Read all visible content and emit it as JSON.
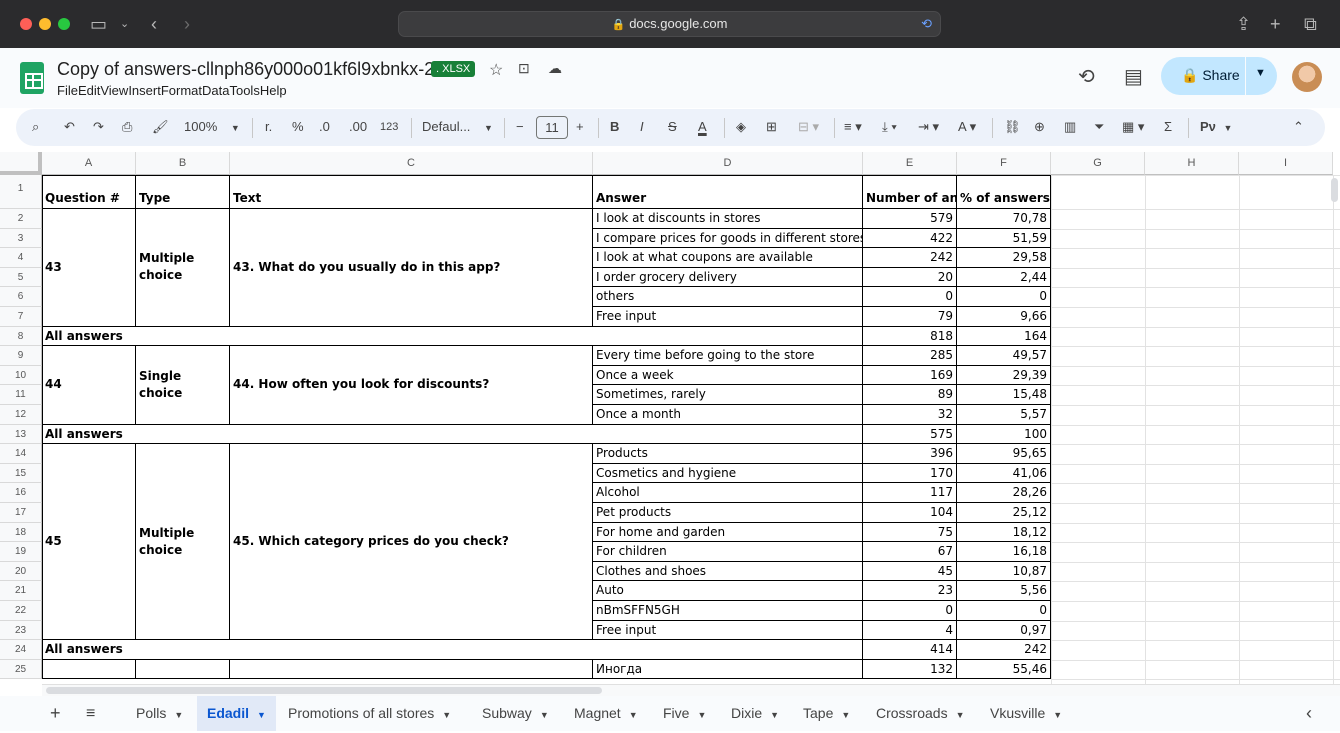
{
  "browser": {
    "url": "docs.google.com"
  },
  "doc": {
    "title": "Copy of answers-cllnph86y000o01kf6l9xbnkx-2",
    "badge": ". XLSX"
  },
  "menu": [
    "File",
    "Edit",
    "View",
    "Insert",
    "Format",
    "Data",
    "Tools",
    "Help"
  ],
  "share": {
    "label": "Share"
  },
  "toolbar": {
    "zoom": "100%",
    "currency": "r.",
    "percent": "%",
    "dec_less": ".0",
    "dec_more": ".00",
    "format123": "123",
    "font": "Defaul...",
    "font_size": "11",
    "bold": "B",
    "italic": "I",
    "strike": "S",
    "text_color": "A",
    "sum": "Σ",
    "input_tools": "Рν"
  },
  "columns": [
    "A",
    "B",
    "C",
    "D",
    "E",
    "F",
    "G",
    "H",
    "I"
  ],
  "rows": [
    {
      "n": "1",
      "a": "Question #",
      "b": "Type",
      "c": "Text",
      "d": "Answer",
      "e": "Number of answers",
      "f": "% of answers"
    },
    {
      "n": "2",
      "d": "I look at discounts in stores",
      "e": "579",
      "f": "70,78"
    },
    {
      "n": "3",
      "d": "I compare prices for goods in different stores",
      "e": "422",
      "f": "51,59"
    },
    {
      "n": "4",
      "d": "I look at what coupons are available",
      "e": "242",
      "f": "29,58"
    },
    {
      "n": "5",
      "d": "I order grocery delivery",
      "e": "20",
      "f": "2,44"
    },
    {
      "n": "6",
      "d": "others",
      "e": "0",
      "f": "0"
    },
    {
      "n": "7",
      "d": "Free input",
      "e": "79",
      "f": "9,66"
    },
    {
      "n": "8",
      "a": "All answers",
      "e": "818",
      "f": "164"
    },
    {
      "n": "9",
      "d": "Every time before going to the store",
      "e": "285",
      "f": "49,57"
    },
    {
      "n": "10",
      "d": "Once a week",
      "e": "169",
      "f": "29,39"
    },
    {
      "n": "11",
      "d": "Sometimes, rarely",
      "e": "89",
      "f": "15,48"
    },
    {
      "n": "12",
      "d": "Once a month",
      "e": "32",
      "f": "5,57"
    },
    {
      "n": "13",
      "a": "All answers",
      "e": "575",
      "f": "100"
    },
    {
      "n": "14",
      "d": "Products",
      "e": "396",
      "f": "95,65"
    },
    {
      "n": "15",
      "d": "Cosmetics and hygiene",
      "e": "170",
      "f": "41,06"
    },
    {
      "n": "16",
      "d": "Alcohol",
      "e": "117",
      "f": "28,26"
    },
    {
      "n": "17",
      "d": "Pet products",
      "e": "104",
      "f": "25,12"
    },
    {
      "n": "18",
      "d": "For home and garden",
      "e": "75",
      "f": "18,12"
    },
    {
      "n": "19",
      "d": "For children",
      "e": "67",
      "f": "16,18"
    },
    {
      "n": "20",
      "d": "Clothes and shoes",
      "e": "45",
      "f": "10,87"
    },
    {
      "n": "21",
      "d": "Auto",
      "e": "23",
      "f": "5,56"
    },
    {
      "n": "22",
      "d": "nBmSFFN5GH",
      "e": "0",
      "f": "0"
    },
    {
      "n": "23",
      "d": "Free input",
      "e": "4",
      "f": "0,97"
    },
    {
      "n": "24",
      "a": "All answers",
      "e": "414",
      "f": "242"
    },
    {
      "n": "25",
      "d": "Иногда",
      "e": "132",
      "f": "55,46"
    }
  ],
  "merged": [
    {
      "q": "43",
      "type": "Multiple choice",
      "text": "43. What do you usually do in this app?"
    },
    {
      "q": "44",
      "type": "Single choice",
      "text": "44. How often you look for discounts?"
    },
    {
      "q": "45",
      "type": "Multiple choice",
      "text": "45. Which category prices do you check?"
    }
  ],
  "tabs": [
    {
      "label": "Polls",
      "active": false
    },
    {
      "label": "Edadil",
      "active": true
    },
    {
      "label": "Promotions of all stores",
      "active": false
    },
    {
      "label": "Subway",
      "active": false
    },
    {
      "label": "Magnet",
      "active": false
    },
    {
      "label": "Five",
      "active": false
    },
    {
      "label": "Dixie",
      "active": false
    },
    {
      "label": "Tape",
      "active": false
    },
    {
      "label": "Crossroads",
      "active": false
    },
    {
      "label": "Vkusville",
      "active": false
    }
  ]
}
